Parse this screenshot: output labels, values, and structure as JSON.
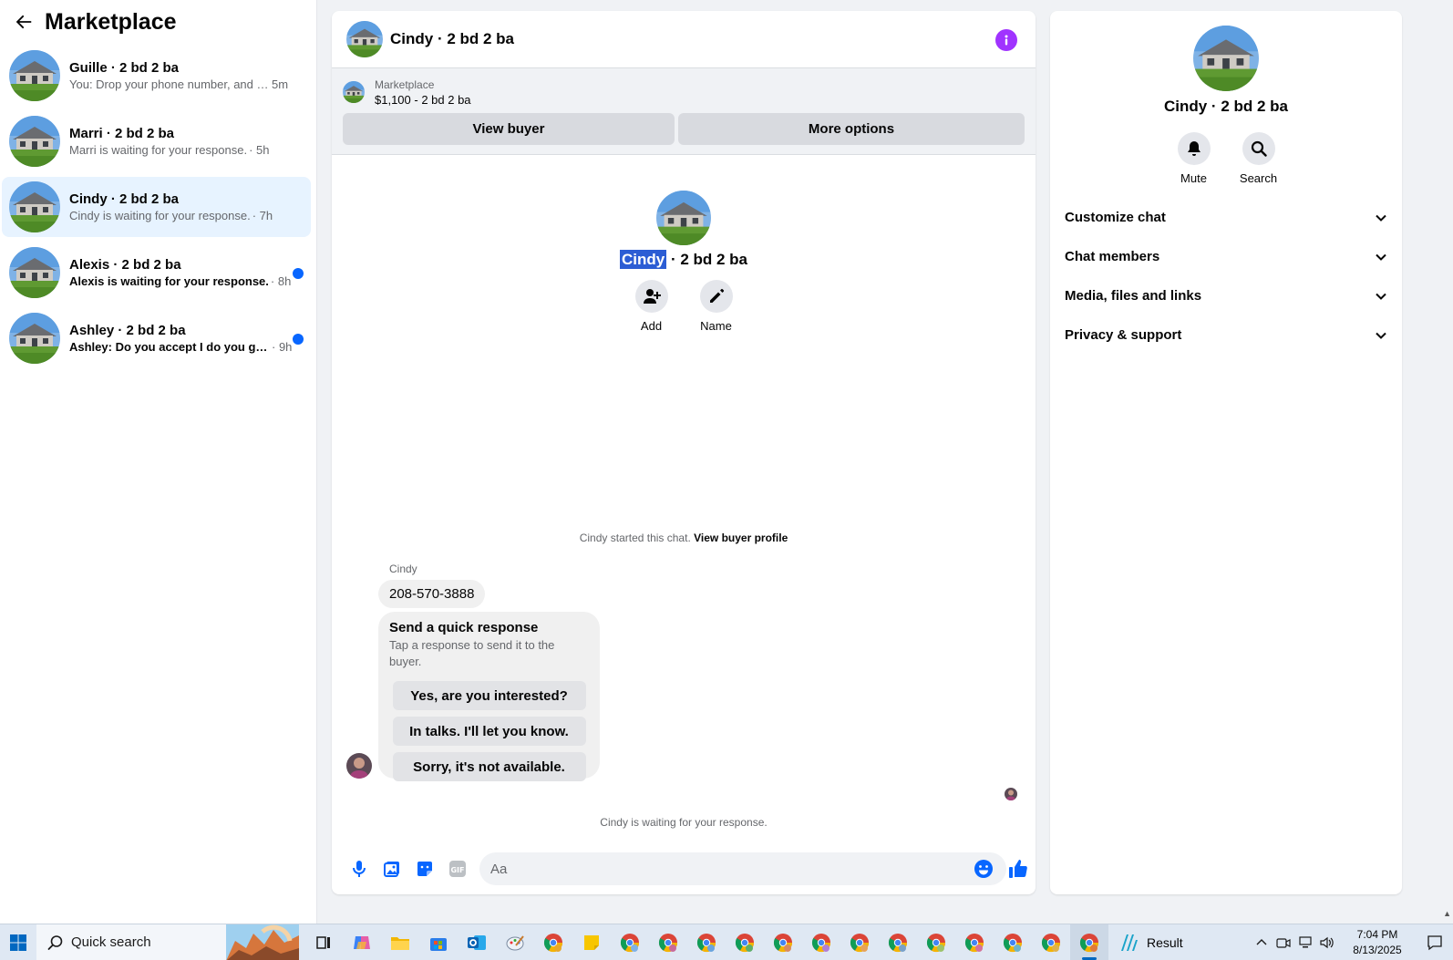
{
  "sidebar": {
    "title": "Marketplace",
    "conversations": [
      {
        "name": "Guille · 2 bd 2 ba",
        "snippet": "You: Drop your phone number, and w...",
        "time": " 5m",
        "unread": false
      },
      {
        "name": "Marri · 2 bd 2 ba",
        "snippet": "Marri is waiting for your response.",
        "time": "· 5h",
        "unread": false
      },
      {
        "name": "Cindy · 2 bd 2 ba",
        "snippet": "Cindy is waiting for your response.",
        "time": "· 7h",
        "unread": false,
        "active": true
      },
      {
        "name": "Alexis · 2 bd 2 ba",
        "snippet": "Alexis is waiting for your response.",
        "time": "· 8h",
        "unread": true
      },
      {
        "name": "Ashley · 2 bd 2 ba",
        "snippet": "Ashley: Do you accept I do you gu...",
        "time": "· 9h",
        "unread": true
      }
    ]
  },
  "chat": {
    "title": "Cindy · 2 bd 2 ba",
    "listing": {
      "label": "Marketplace",
      "price": "$1,100 - 2 bd 2 ba"
    },
    "buttons": {
      "view_buyer": "View buyer",
      "more_options": "More options"
    },
    "center": {
      "name_highlight": "Cindy",
      "name_rest": " · 2 bd 2 ba",
      "add": "Add",
      "name": "Name"
    },
    "started": "Cindy started this chat.",
    "view_buyer_profile": "View buyer profile",
    "sender": "Cindy",
    "phone_message": "208-570-3888",
    "quick_response": {
      "title": "Send a quick response",
      "subtitle": "Tap a response to send it to the buyer.",
      "options": [
        "Yes, are you interested?",
        "In talks. I'll let you know.",
        "Sorry, it's not available."
      ]
    },
    "waiting": "Cindy is waiting for your response.",
    "composer_placeholder": "Aa"
  },
  "right_panel": {
    "title": "Cindy · 2 bd 2 ba",
    "mute": "Mute",
    "search": "Search",
    "sections": [
      "Customize chat",
      "Chat members",
      "Media, files and links",
      "Privacy & support"
    ]
  },
  "taskbar": {
    "search_text": "Quick search",
    "result": "Result",
    "time": "7:04 PM",
    "date": "8/13/2025"
  },
  "colors": {
    "accent": "#0866ff",
    "info": "#a033ff",
    "active_conversation": "#e7f3ff",
    "highlight": "#2c5dd4"
  }
}
